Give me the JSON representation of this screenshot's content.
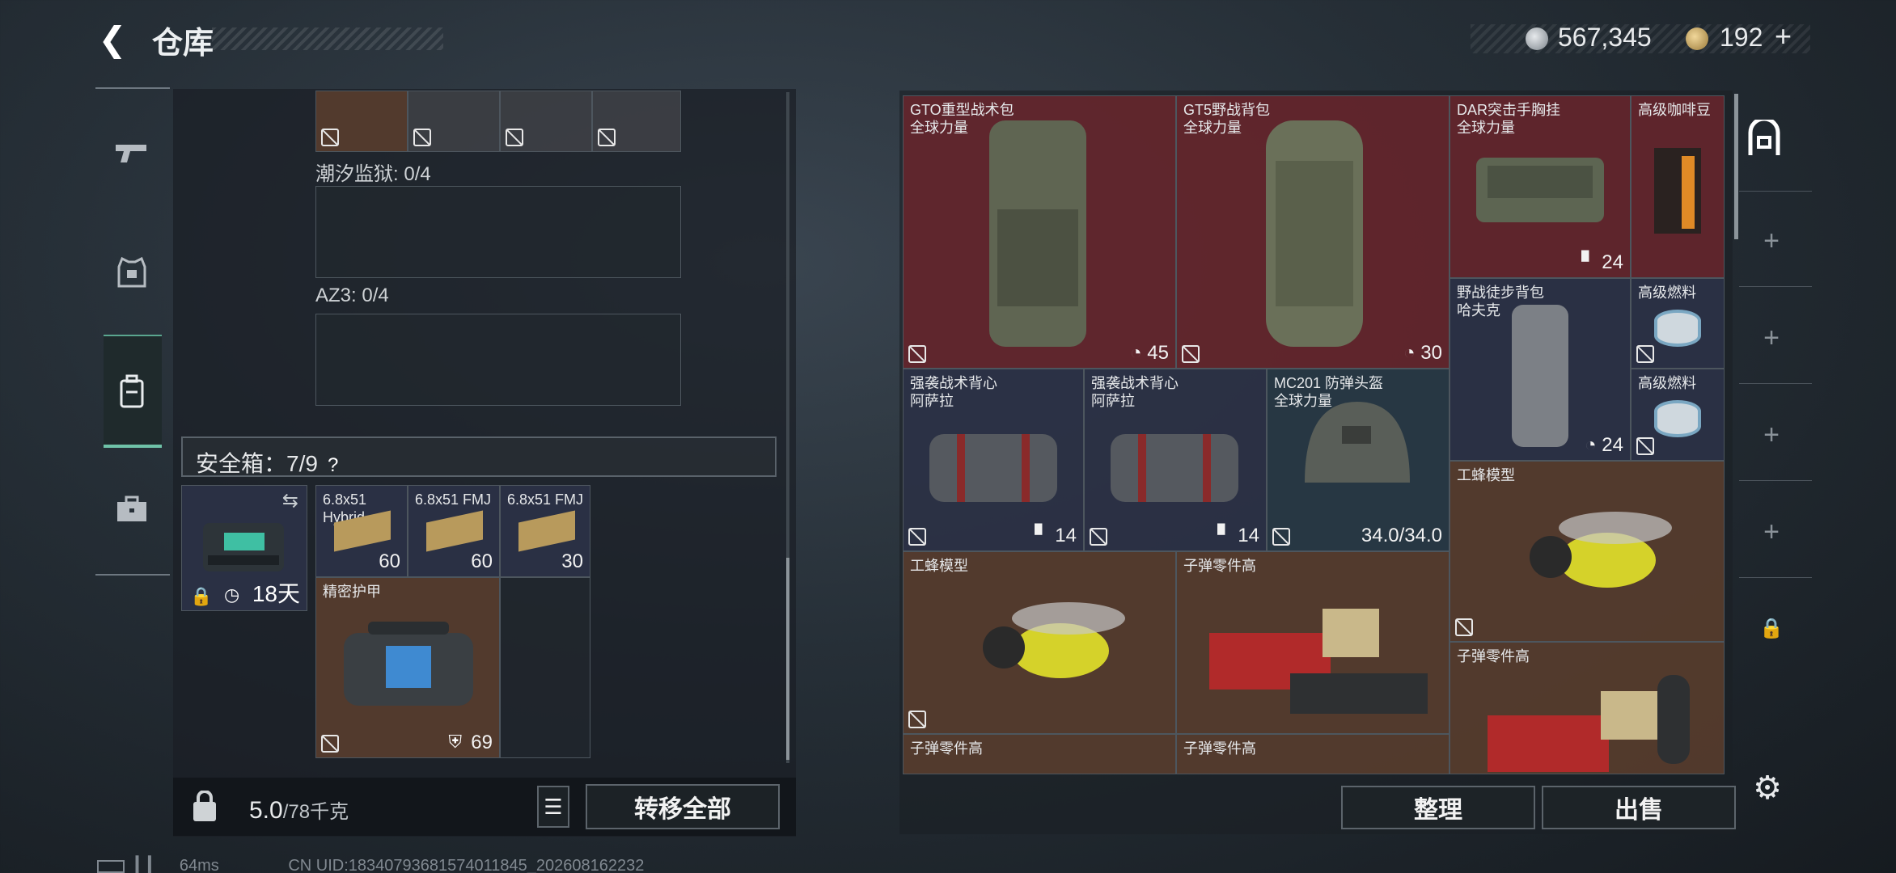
{
  "header": {
    "title": "仓库"
  },
  "currency": {
    "silver": "567,345",
    "gold": "192",
    "plus": "+"
  },
  "left": {
    "slots": [
      {
        "name": "潮汐监狱",
        "count": "0/4"
      },
      {
        "name": "AZ3",
        "count": "0/4"
      }
    ],
    "safebox": {
      "label": "安全箱：7/9",
      "days": "18天",
      "help": "?"
    },
    "items": [
      {
        "name": "6.8x51 Hybrid...",
        "count": "60"
      },
      {
        "name": "6.8x51 FMJ",
        "count": "60"
      },
      {
        "name": "6.8x51 FMJ",
        "count": "30"
      },
      {
        "name": "精密护甲",
        "count": "69"
      }
    ],
    "weight": {
      "value": "5.0",
      "max": "/78千克"
    },
    "transfer_all": "转移全部"
  },
  "right": {
    "items": [
      {
        "name": "GTO重型战术包",
        "sub": "全球力量",
        "count": "45"
      },
      {
        "name": "GT5野战背包",
        "sub": "全球力量",
        "count": "30"
      },
      {
        "name": "DAR突击手胸挂",
        "sub": "全球力量",
        "count": "24"
      },
      {
        "name": "高级咖啡豆",
        "sub": "",
        "count": ""
      },
      {
        "name": "野战徒步背包",
        "sub": "哈夫克",
        "count": "24"
      },
      {
        "name": "高级燃料",
        "sub": "",
        "count": ""
      },
      {
        "name": "高级燃料",
        "sub": "",
        "count": ""
      },
      {
        "name": "强袭战术背心",
        "sub": "阿萨拉",
        "count": "14"
      },
      {
        "name": "强袭战术背心",
        "sub": "阿萨拉",
        "count": "14"
      },
      {
        "name": "MC201 防弹头盔",
        "sub": "全球力量",
        "count": "34.0/34.0"
      },
      {
        "name": "工蜂模型",
        "sub": "",
        "count": ""
      },
      {
        "name": "工蜂模型",
        "sub": "",
        "count": ""
      },
      {
        "name": "子弹零件高",
        "sub": "",
        "count": ""
      },
      {
        "name": "子弹零件高",
        "sub": "",
        "count": ""
      },
      {
        "name": "子弹零件高",
        "sub": "",
        "count": ""
      },
      {
        "name": "子弹零件高",
        "sub": "",
        "count": ""
      }
    ],
    "sort_button": "整理",
    "sell_button": "出售"
  },
  "status": {
    "ping": "64ms",
    "uid": "CN UID:18340793681574011845_202608162232"
  },
  "colors": {
    "accent": "#6fc2a8",
    "red_cell": "#68262c",
    "navy_cell": "#2c3248",
    "brown_cell": "#5c3e2e"
  }
}
